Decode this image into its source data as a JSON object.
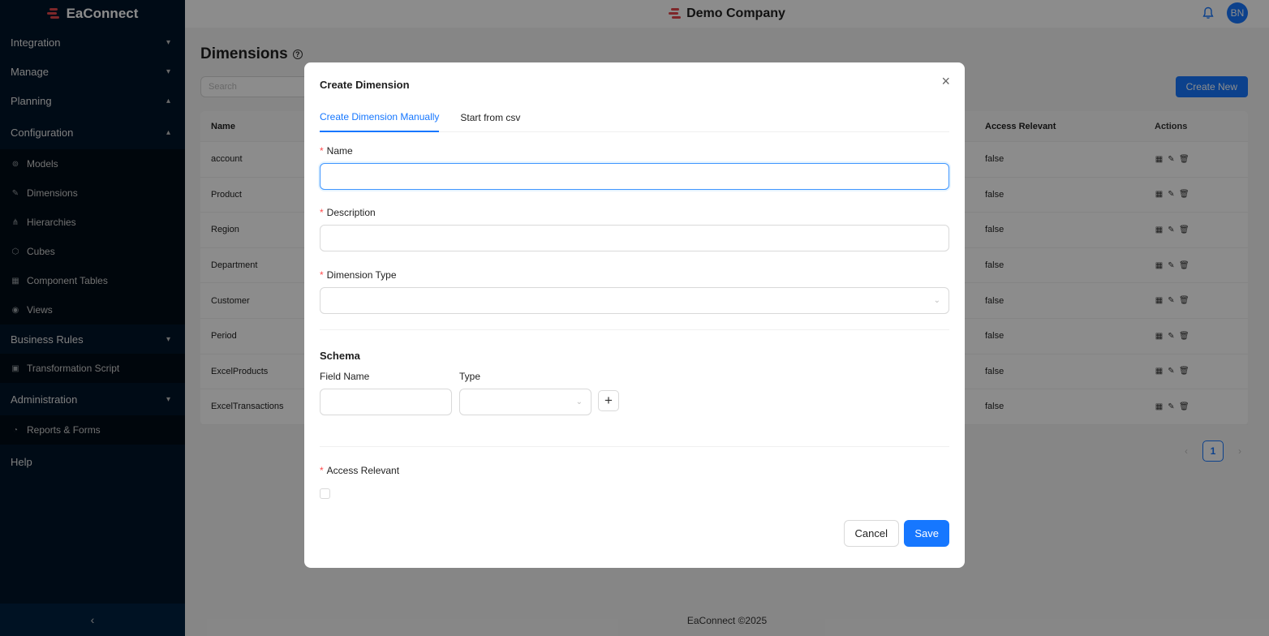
{
  "app": {
    "name": "EaConnect"
  },
  "header": {
    "company": "Demo Company",
    "avatar_initials": "BN"
  },
  "sidebar": {
    "sections": [
      {
        "label": "Integration",
        "chevron": "⌄"
      },
      {
        "label": "Manage",
        "chevron": "⌄"
      },
      {
        "label": "Planning",
        "chevron": "⌃"
      },
      {
        "label": "Configuration",
        "chevron": "⌃"
      }
    ],
    "config_items": [
      {
        "label": "Models",
        "icon": "models-icon"
      },
      {
        "label": "Dimensions",
        "icon": "dimensions-icon"
      },
      {
        "label": "Hierarchies",
        "icon": "hierarchies-icon"
      },
      {
        "label": "Cubes",
        "icon": "cube-icon"
      },
      {
        "label": "Component Tables",
        "icon": "table-icon"
      },
      {
        "label": "Views",
        "icon": "eye-icon"
      }
    ],
    "business_rules": {
      "label": "Business Rules",
      "chevron": "⌄"
    },
    "transformation_script": {
      "label": "Transformation Script"
    },
    "administration": {
      "label": "Administration",
      "chevron": "⌄"
    },
    "reports_forms": {
      "label": "Reports & Forms"
    },
    "help": {
      "label": "Help"
    },
    "collapse_glyph": "‹"
  },
  "page": {
    "title": "Dimensions",
    "search_placeholder": "Search",
    "create_button": "Create New",
    "columns": {
      "name": "Name",
      "access": "Access Relevant",
      "actions": "Actions"
    },
    "rows": [
      {
        "name": "account",
        "access": "false"
      },
      {
        "name": "Product",
        "access": "false"
      },
      {
        "name": "Region",
        "access": "false"
      },
      {
        "name": "Department",
        "access": "false"
      },
      {
        "name": "Customer",
        "access": "false"
      },
      {
        "name": "Period",
        "access": "false"
      },
      {
        "name": "ExcelProducts",
        "access": "false"
      },
      {
        "name": "ExcelTransactions",
        "access": "false"
      }
    ],
    "pagination": {
      "prev": "‹",
      "current": "1",
      "next": "›"
    }
  },
  "footer": {
    "text": "EaConnect ©2025"
  },
  "modal": {
    "title": "Create Dimension",
    "tabs": [
      {
        "label": "Create Dimension Manually"
      },
      {
        "label": "Start from csv"
      }
    ],
    "fields": {
      "name_label": "Name",
      "name_value": "",
      "description_label": "Description",
      "description_value": "",
      "type_label": "Dimension Type",
      "type_value": ""
    },
    "schema": {
      "title": "Schema",
      "field_name_label": "Field Name",
      "type_label": "Type",
      "field_name_value": "",
      "type_value": ""
    },
    "access_label": "Access Relevant",
    "access_checked": false,
    "cancel": "Cancel",
    "save": "Save",
    "required_mark": "*",
    "close_glyph": "×",
    "add_glyph": "+"
  },
  "colors": {
    "primary": "#1677ff",
    "sidebar_bg": "#001529",
    "required": "#ff4d4f",
    "logo_red": "#e5484d"
  }
}
